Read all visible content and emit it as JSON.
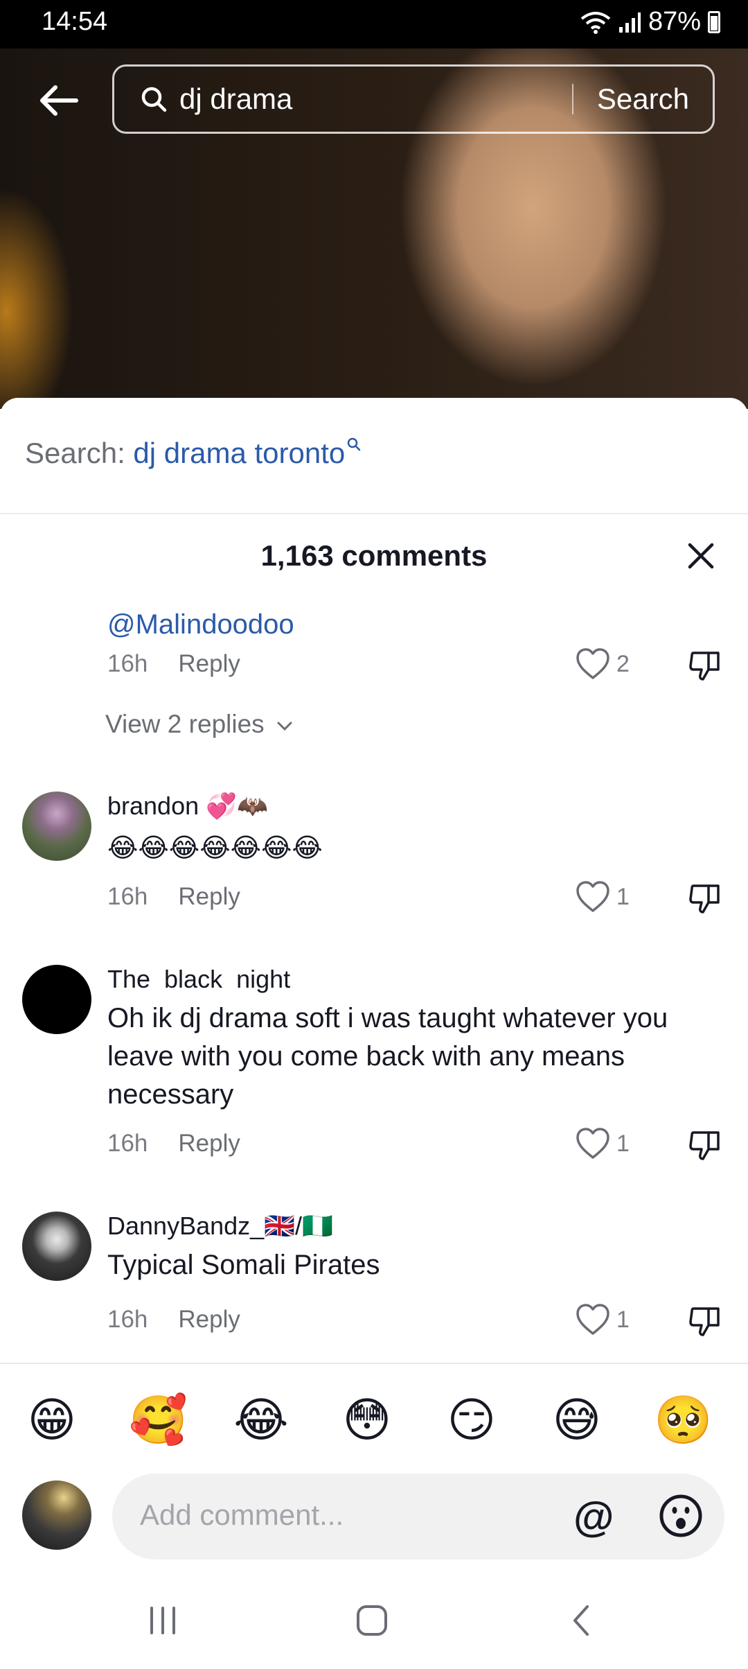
{
  "status_bar": {
    "time": "14:54",
    "battery": "87%"
  },
  "search": {
    "query": "dj drama",
    "button": "Search"
  },
  "related_search": {
    "prefix": "Search: ",
    "query": "dj drama toronto"
  },
  "comments_header": {
    "count_label": "1,163 comments"
  },
  "comments": [
    {
      "text_mention": "@Malindoodoo",
      "time": "16h",
      "reply": "Reply",
      "likes": "2",
      "view_replies": "View 2 replies"
    },
    {
      "username": "brandon 💞🦇",
      "text": "😂😂😂😂😂😂😂",
      "time": "16h",
      "reply": "Reply",
      "likes": "1"
    },
    {
      "username": "The  black  night",
      "text": "Oh ik dj drama soft i was taught whatever you leave with you come back with any means necessary",
      "time": "16h",
      "reply": "Reply",
      "likes": "1"
    },
    {
      "username": "DannyBandz_🇬🇧/🇳🇬",
      "text": "Typical Somali Pirates",
      "time": "16h",
      "reply": "Reply",
      "likes": "1"
    }
  ],
  "emoji_bar": [
    "😁",
    "🥰",
    "😂",
    "😳",
    "😏",
    "😅",
    "🥺"
  ],
  "composer": {
    "placeholder": "Add comment...",
    "at_symbol": "@"
  },
  "colors": {
    "link": "#2b5aa8",
    "muted": "#7a7b82",
    "text": "#161823"
  }
}
